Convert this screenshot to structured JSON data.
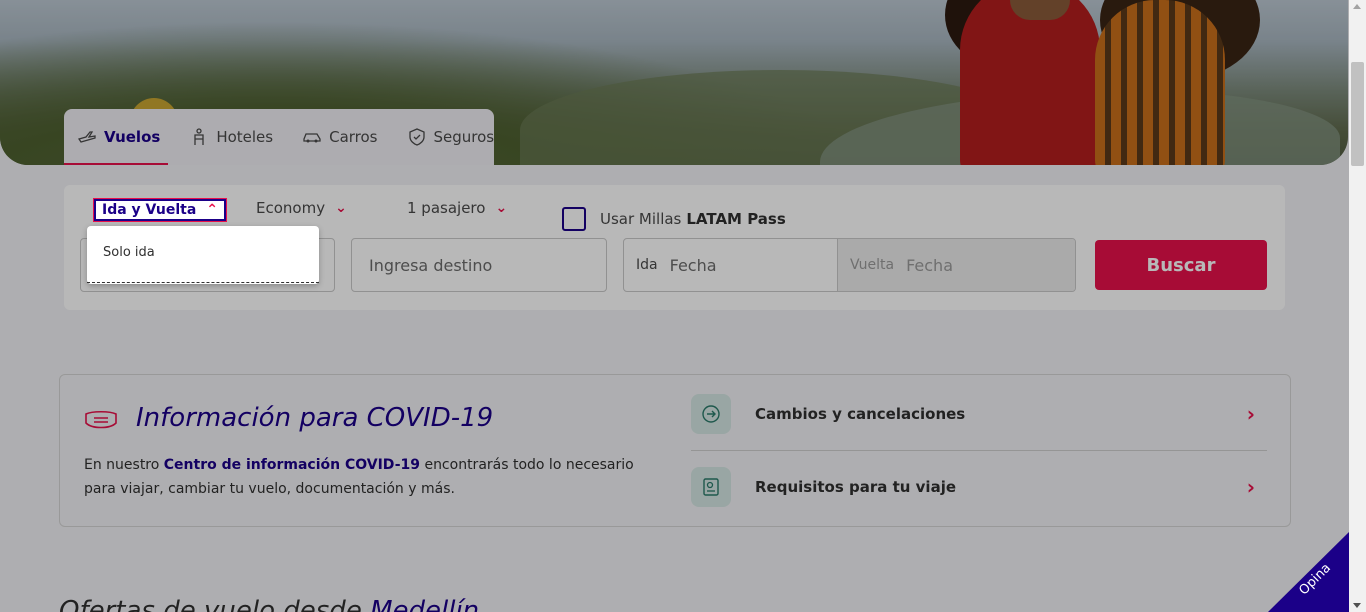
{
  "tabs": [
    {
      "label": "Vuelos",
      "icon": "plane-icon",
      "active": true
    },
    {
      "label": "Hoteles",
      "icon": "hotel-icon",
      "active": false
    },
    {
      "label": "Carros",
      "icon": "car-icon",
      "active": false
    },
    {
      "label": "Seguros",
      "icon": "shield-icon",
      "active": false
    }
  ],
  "search": {
    "trip_type": "Ida y Vuelta",
    "cabin": "Economy",
    "passengers": "1 pasajero",
    "miles_label": "Usar Millas",
    "miles_brand": "LATAM Pass",
    "destination_placeholder": "Ingresa destino",
    "ida_label": "Ida",
    "ida_placeholder": "Fecha",
    "vuelta_label": "Vuelta",
    "vuelta_placeholder": "Fecha",
    "button": "Buscar"
  },
  "dropdown": {
    "items": [
      "Solo ida"
    ]
  },
  "covid": {
    "title": "Información para COVID-19",
    "text_before": "En nuestro ",
    "link": "Centro de información COVID-19",
    "text_after": " encontrarás todo lo necesario para viajar, cambiar tu vuelo, documentación y más.",
    "links": [
      {
        "label": "Cambios y cancelaciones",
        "icon": "change-calendar-icon"
      },
      {
        "label": "Requisitos para tu viaje",
        "icon": "passport-icon"
      }
    ]
  },
  "ofertas": {
    "prefix": "Ofertas de vuelo desde ",
    "city": "Medellín"
  },
  "opina": "Opina",
  "colors": {
    "brand": "#1b0088",
    "accent": "#e8114b"
  }
}
